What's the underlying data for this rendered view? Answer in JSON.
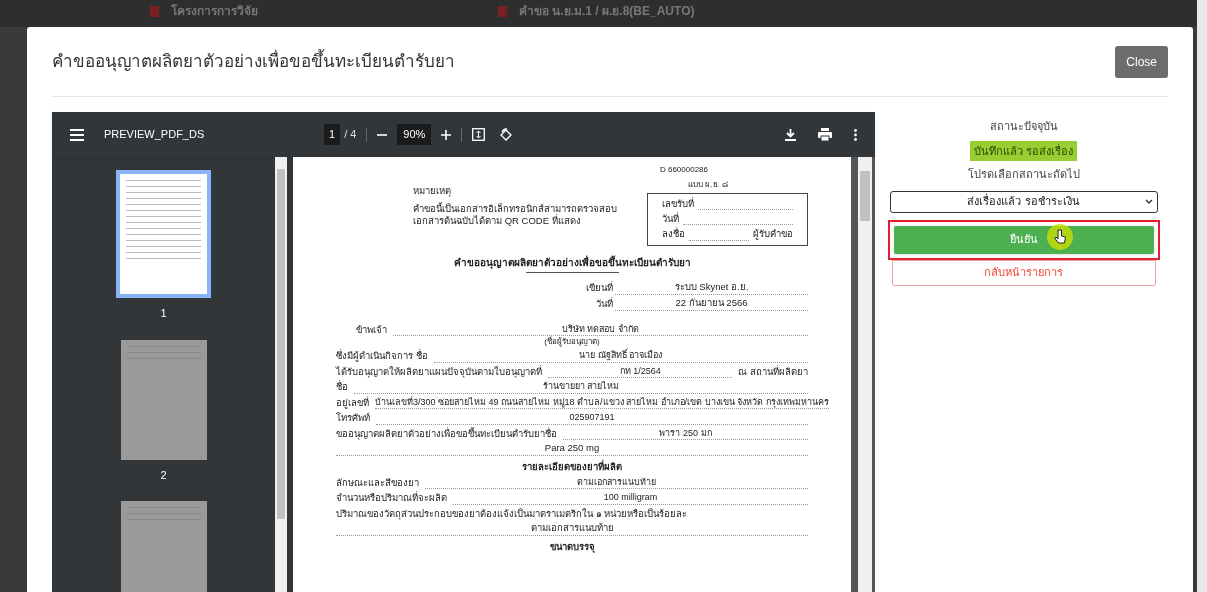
{
  "background_tabs": [
    {
      "label": "โครงการการวิจัย"
    },
    {
      "label": "คำขอ น.ย.ม.1 / ผ.ย.8(BE_AUTO)"
    }
  ],
  "modal": {
    "title": "คำขออนุญาตผลิตยาตัวอย่างเพื่อขอขึ้นทะเบียนตำรับยา",
    "close_button": "Close"
  },
  "pdf_viewer": {
    "file_name": "PREVIEW_PDF_DS",
    "page_current": "1",
    "page_total": "/ 4",
    "zoom": "90%",
    "thumbnails": [
      {
        "label": "1",
        "selected": true
      },
      {
        "label": "2",
        "selected": false
      },
      {
        "selected": false
      }
    ]
  },
  "document": {
    "code": "D 660000286",
    "form": "แบบ ผ.ย. ๘",
    "note_title": "หมายเหตุ",
    "note_lines": [
      "คำขอนี้เป็นเอกสารอิเล็กทรอนิกส์สามารถตรวจสอบ",
      "เอกสารต้นฉบับได้ตาม QR CODE ที่แสดง"
    ],
    "receipt_fields": [
      {
        "label": "เลขรับที่"
      },
      {
        "label": "วันที่"
      },
      {
        "label": "ลงชื่อ",
        "suffix": "ผู้รับคำขอ"
      }
    ],
    "heading": "คำขออนุญาตผลิตยาตัวอย่างเพื่อขอขึ้นทะเบียนตำรับยา",
    "written_at": [
      {
        "label": "เขียนที่",
        "value": "ระบบ Skynet อ.ย."
      },
      {
        "label": "วันที่",
        "value": "22 กันยายน 2566"
      }
    ],
    "rows": [
      {
        "kind": "field",
        "indent": true,
        "label": "ข้าพเจ้า",
        "value": "บริษัท ทดสอบ จำกัด"
      },
      {
        "kind": "caption",
        "value": "(ชื่อผู้รับอนุญาต)"
      },
      {
        "kind": "field",
        "label": "ซึ่งมีผู้ดำเนินกิจการ ชื่อ",
        "value": "นาย ณัฐสิทธิ์  อาจเมือง"
      },
      {
        "kind": "field",
        "label": "ได้รับอนุญาตให้ผลิตยาแผนปัจจุบันตามใบอนุญาตที่",
        "value": "กท 1/2564",
        "suffix": "ณ สถานที่ผลิตยา"
      },
      {
        "kind": "field",
        "label": "ชื่อ",
        "value": "ร้านขายยา สายไหม"
      },
      {
        "kind": "field",
        "label": "อยู่เลขที่",
        "value": "บ้านเลขที่3/300 ซอยสายไหม 49 ถนนสายไหม หมู่18 ตำบล/แขวง สายไหม อำเภอ/เขต บางเขน จังหวัด กรุงเทพมหานคร"
      },
      {
        "kind": "field",
        "label": "โทรศัพท์",
        "value": "025907191"
      },
      {
        "kind": "field",
        "label": "ขออนุญาตผลิตยาตัวอย่างเพื่อขอขึ้นทะเบียนตำรับยาชื่อ",
        "value": "พารา 250 มก"
      },
      {
        "kind": "continuation",
        "value": "Para 250 mg"
      },
      {
        "kind": "heading",
        "value": "รายละเอียดของยาที่ผลิต"
      },
      {
        "kind": "field",
        "label": "ลักษณะและสีของยา",
        "value": "ตามเอกสารแนบท้าย"
      },
      {
        "kind": "field",
        "label": "จำนวนหรือปริมาณที่จะผลิต",
        "value": "100 milligram"
      },
      {
        "kind": "text",
        "value": "ปริมาณของวัตถุส่วนประกอบของยาต้องแจ้งเป็นมาตราเมตริกใน ๑ หน่วยหรือเป็นร้อยละ"
      },
      {
        "kind": "continuation",
        "value": "ตามเอกสารแนบท้าย"
      },
      {
        "kind": "heading",
        "value": "ขนาดบรรจุ"
      }
    ]
  },
  "status_panel": {
    "current_label": "สถานะปัจจุบัน",
    "current_status": "บันทึกแล้ว รอส่งเรื่อง",
    "next_label": "โปรดเลือกสถานะถัดไป",
    "next_status": "ส่งเรื่องแล้ว รอชำระเงิน",
    "confirm_button": "ยืนยัน",
    "back_button": "กลับหน้ารายการ"
  }
}
